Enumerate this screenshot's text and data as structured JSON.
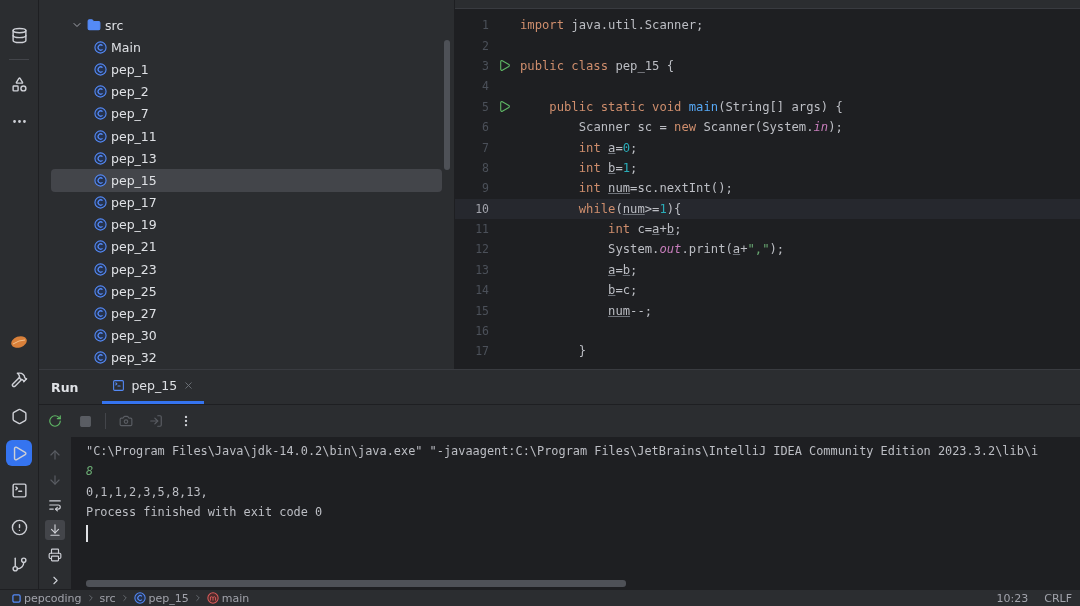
{
  "project_tree": {
    "label": "src",
    "expanded": true,
    "children": [
      {
        "label": "Main",
        "selected": false
      },
      {
        "label": "pep_1",
        "selected": false
      },
      {
        "label": "pep_2",
        "selected": false
      },
      {
        "label": "pep_7",
        "selected": false
      },
      {
        "label": "pep_11",
        "selected": false
      },
      {
        "label": "pep_13",
        "selected": false
      },
      {
        "label": "pep_15",
        "selected": true
      },
      {
        "label": "pep_17",
        "selected": false
      },
      {
        "label": "pep_19",
        "selected": false
      },
      {
        "label": "pep_21",
        "selected": false
      },
      {
        "label": "pep_23",
        "selected": false
      },
      {
        "label": "pep_25",
        "selected": false
      },
      {
        "label": "pep_27",
        "selected": false
      },
      {
        "label": "pep_30",
        "selected": false
      },
      {
        "label": "pep_32",
        "selected": false
      }
    ]
  },
  "editor": {
    "lines": [
      {
        "number": "1",
        "runnable": false,
        "current": false,
        "tokens": [
          {
            "kind": "keyword",
            "text": "import"
          },
          {
            "kind": "plain",
            "text": " java.util.Scanner;"
          }
        ]
      },
      {
        "number": "2",
        "runnable": false,
        "current": false
      },
      {
        "number": "3",
        "runnable": true,
        "current": false,
        "tokens": [
          {
            "kind": "keyword",
            "text": "public class"
          },
          {
            "kind": "plain",
            "text": " pep_15 {"
          }
        ]
      },
      {
        "number": "4",
        "runnable": false,
        "current": false
      },
      {
        "number": "5",
        "runnable": true,
        "current": false,
        "tokens": [
          {
            "kind": "keyword",
            "text": "    public static void "
          },
          {
            "kind": "method",
            "text": "main"
          },
          {
            "kind": "plain",
            "text": "(String[] args) {"
          }
        ]
      },
      {
        "number": "6",
        "runnable": false,
        "current": false,
        "tokens": [
          {
            "kind": "plain",
            "text": "        Scanner sc = "
          },
          {
            "kind": "keyword",
            "text": "new"
          },
          {
            "kind": "plain",
            "text": " Scanner(System."
          },
          {
            "kind": "field",
            "text": "in"
          },
          {
            "kind": "plain",
            "text": ");"
          }
        ]
      },
      {
        "number": "7",
        "runnable": false,
        "current": false,
        "tokens": [
          {
            "kind": "keyword",
            "text": "        int "
          },
          {
            "kind": "var",
            "text": "a"
          },
          {
            "kind": "plain",
            "text": "="
          },
          {
            "kind": "number",
            "text": "0"
          },
          {
            "kind": "plain",
            "text": ";"
          }
        ]
      },
      {
        "number": "8",
        "runnable": false,
        "current": false,
        "tokens": [
          {
            "kind": "keyword",
            "text": "        int "
          },
          {
            "kind": "var",
            "text": "b"
          },
          {
            "kind": "plain",
            "text": "="
          },
          {
            "kind": "number",
            "text": "1"
          },
          {
            "kind": "plain",
            "text": ";"
          }
        ]
      },
      {
        "number": "9",
        "runnable": false,
        "current": false,
        "tokens": [
          {
            "kind": "keyword",
            "text": "        int "
          },
          {
            "kind": "var",
            "text": "num"
          },
          {
            "kind": "plain",
            "text": "=sc.nextInt();"
          }
        ]
      },
      {
        "number": "10",
        "runnable": false,
        "current": true,
        "tokens": [
          {
            "kind": "keyword",
            "text": "        while"
          },
          {
            "kind": "plain",
            "text": "("
          },
          {
            "kind": "var",
            "text": "num"
          },
          {
            "kind": "plain",
            "text": ">="
          },
          {
            "kind": "number",
            "text": "1"
          },
          {
            "kind": "plain",
            "text": "){"
          }
        ]
      },
      {
        "number": "11",
        "runnable": false,
        "current": false,
        "tokens": [
          {
            "kind": "keyword",
            "text": "            int"
          },
          {
            "kind": "plain",
            "text": " c="
          },
          {
            "kind": "var",
            "text": "a"
          },
          {
            "kind": "plain",
            "text": "+"
          },
          {
            "kind": "var",
            "text": "b"
          },
          {
            "kind": "plain",
            "text": ";"
          }
        ]
      },
      {
        "number": "12",
        "runnable": false,
        "current": false,
        "tokens": [
          {
            "kind": "plain",
            "text": "            System."
          },
          {
            "kind": "field",
            "text": "out"
          },
          {
            "kind": "plain",
            "text": ".print("
          },
          {
            "kind": "var",
            "text": "a"
          },
          {
            "kind": "plain",
            "text": "+"
          },
          {
            "kind": "string",
            "text": "\",\""
          },
          {
            "kind": "plain",
            "text": ");"
          }
        ]
      },
      {
        "number": "13",
        "runnable": false,
        "current": false,
        "tokens": [
          {
            "kind": "var",
            "text": "            a"
          },
          {
            "kind": "plain",
            "text": "="
          },
          {
            "kind": "var",
            "text": "b"
          },
          {
            "kind": "plain",
            "text": ";"
          }
        ]
      },
      {
        "number": "14",
        "runnable": false,
        "current": false,
        "tokens": [
          {
            "kind": "var",
            "text": "            b"
          },
          {
            "kind": "plain",
            "text": "=c;"
          }
        ]
      },
      {
        "number": "15",
        "runnable": false,
        "current": false,
        "tokens": [
          {
            "kind": "var",
            "text": "            num"
          },
          {
            "kind": "plain",
            "text": "--;"
          }
        ]
      },
      {
        "number": "16",
        "runnable": false,
        "current": false
      },
      {
        "number": "17",
        "runnable": false,
        "current": false,
        "tokens": [
          {
            "kind": "plain",
            "text": "        }"
          }
        ]
      }
    ]
  },
  "run_panel": {
    "title": "Run",
    "tabs": [
      {
        "label": "pep_15",
        "selected": true
      }
    ],
    "console": [
      {
        "kind": "command",
        "text": "\"C:\\Program Files\\Java\\jdk-14.0.2\\bin\\java.exe\" \"-javaagent:C:\\Program Files\\JetBrains\\IntelliJ IDEA Community Edition 2023.3.2\\lib\\i"
      },
      {
        "kind": "input",
        "text": "8"
      },
      {
        "kind": "output",
        "text": "0,1,1,2,3,5,8,13,"
      },
      {
        "kind": "output",
        "text": "Process finished with exit code 0"
      }
    ]
  },
  "status_bar": {
    "breadcrumbs": [
      {
        "kind": "module",
        "label": "pepcoding"
      },
      {
        "kind": "folder",
        "label": "src"
      },
      {
        "kind": "class",
        "label": "pep_15"
      },
      {
        "kind": "method",
        "label": "main"
      }
    ],
    "items": [
      "10:23",
      "CRLF"
    ]
  }
}
